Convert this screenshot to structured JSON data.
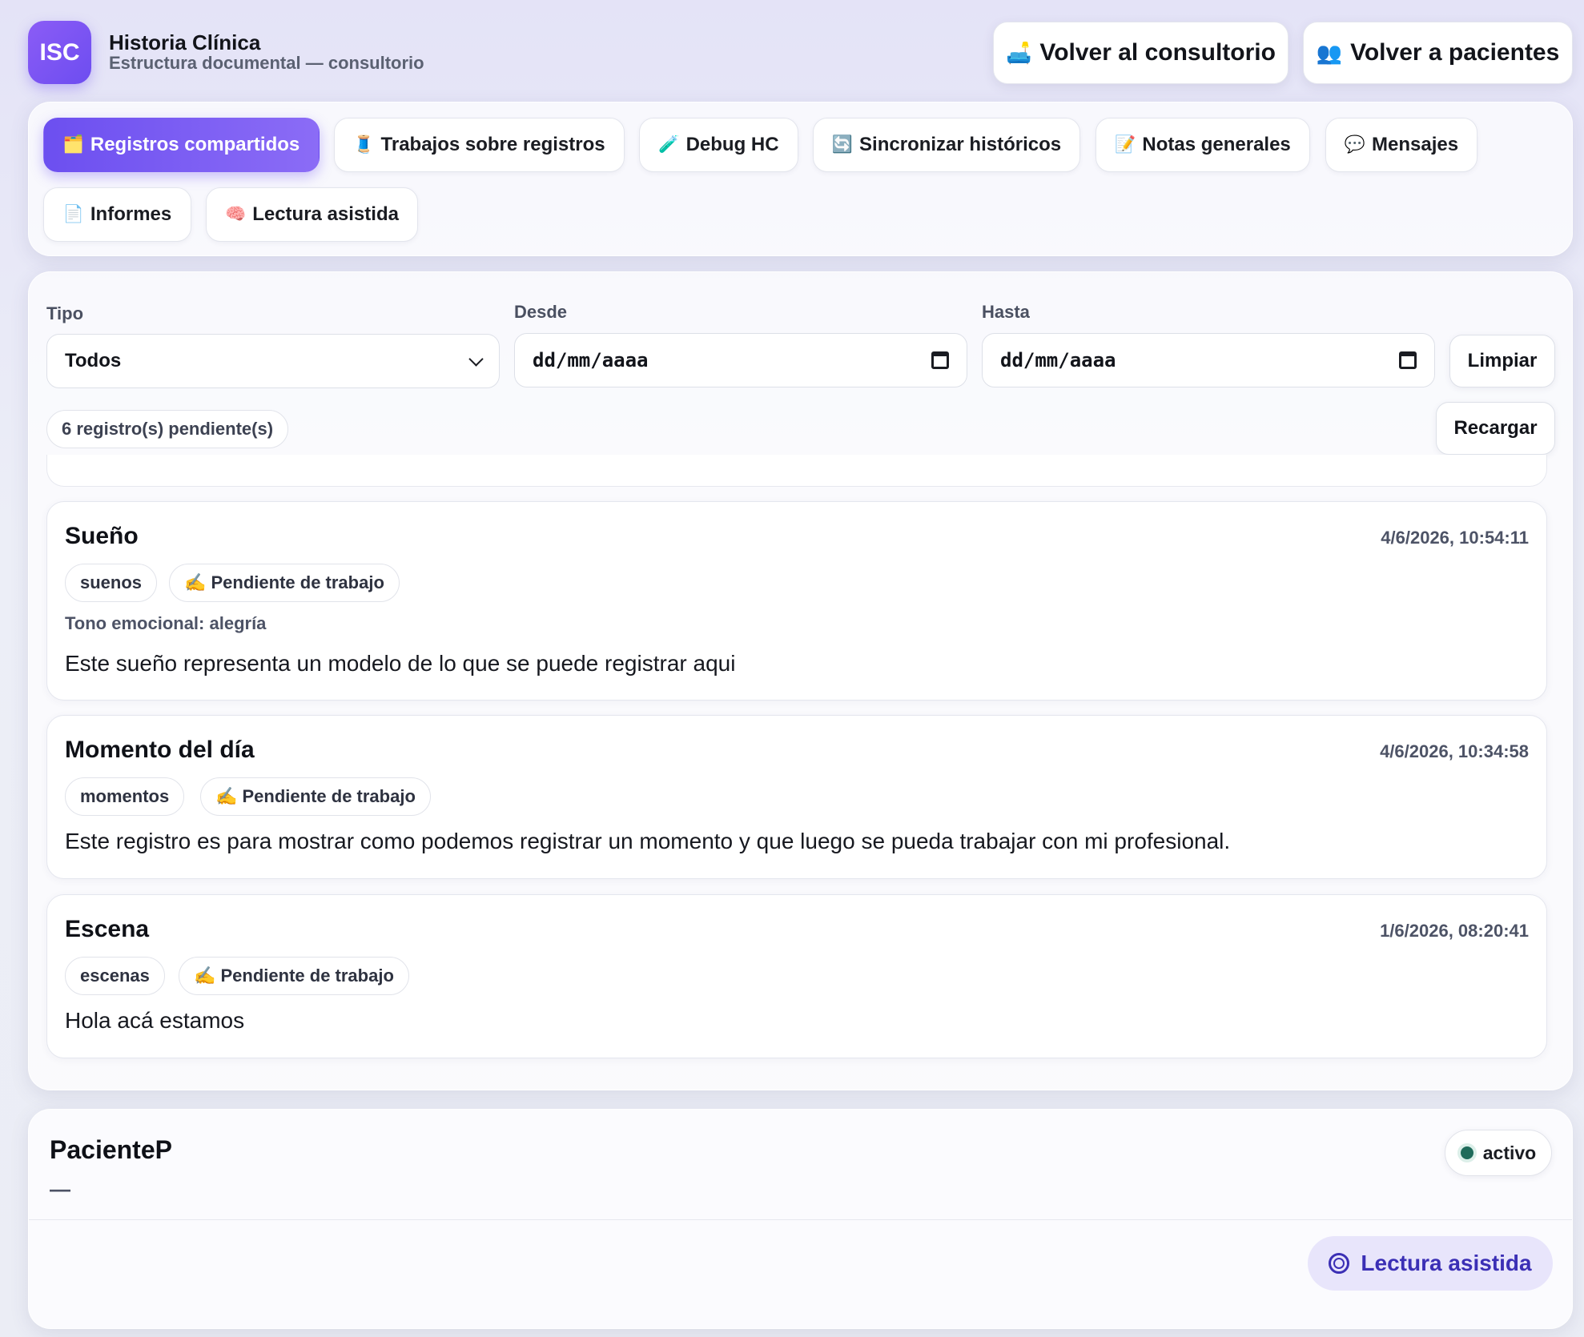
{
  "header": {
    "logo": "ISC",
    "title": "Historia Clínica",
    "subtitle": "Estructura documental — consultorio",
    "back_consultorio": {
      "icon": "🛋️",
      "label": "Volver al consultorio"
    },
    "back_pacientes": {
      "icon": "👥",
      "label": "Volver a pacientes"
    }
  },
  "tabs": [
    {
      "icon": "🗂️",
      "label": "Registros compartidos",
      "active": true
    },
    {
      "icon": "🧵",
      "label": "Trabajos sobre registros"
    },
    {
      "icon": "🧪",
      "label": "Debug HC"
    },
    {
      "icon": "🔄",
      "label": "Sincronizar históricos"
    },
    {
      "icon": "📝",
      "label": "Notas generales"
    },
    {
      "icon": "💬",
      "label": "Mensajes"
    },
    {
      "icon": "📄",
      "label": "Informes"
    },
    {
      "icon": "🧠",
      "label": "Lectura asistida"
    }
  ],
  "filters": {
    "tipo_label": "Tipo",
    "tipo_value": "Todos",
    "desde_label": "Desde",
    "desde_value": "dd/mm/aaaa",
    "hasta_label": "Hasta",
    "hasta_value": "dd/mm/aaaa",
    "limpiar": "Limpiar",
    "recargar": "Recargar",
    "pending_count": "6 registro(s) pendiente(s)"
  },
  "records": [
    {
      "title": "Sueño",
      "date": "4/6/2026, 10:54:11",
      "tag": "suenos",
      "status": "✍️ Pendiente de trabajo",
      "tone": "Tono emocional: alegría",
      "body": "Este sueño representa un modelo de lo que se puede registrar aqui"
    },
    {
      "title": "Momento del día",
      "date": "4/6/2026, 10:34:58",
      "tag": "momentos",
      "status": "✍️ Pendiente de trabajo",
      "body": "Este registro es para mostrar como podemos registrar un momento y que luego se pueda trabajar con mi profesional."
    },
    {
      "title": "Escena",
      "date": "1/6/2026, 08:20:41",
      "tag": "escenas",
      "status": "✍️ Pendiente de trabajo",
      "body": "Hola acá estamos"
    }
  ],
  "patient": {
    "name": "PacienteP",
    "detail": "—",
    "status": "activo",
    "status_color": "#1f6b5a"
  },
  "fab": {
    "label": "Lectura asistida"
  },
  "colors": {
    "accent": "#6c4ff0",
    "fab_text": "#3b2fb5"
  }
}
